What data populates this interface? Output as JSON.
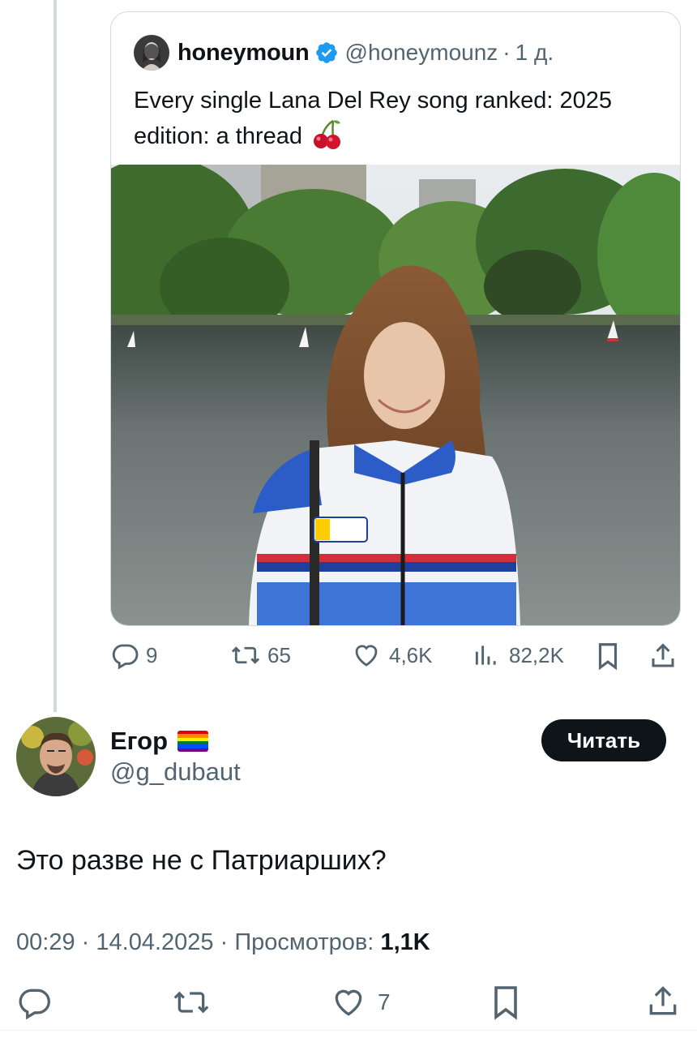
{
  "quoted_tweet": {
    "author_name": "honeymoun",
    "handle": "@honeymounz",
    "separator": "·",
    "time": "1 д.",
    "text": "Every single Lana Del Rey song ranked: 2025 edition: a thread",
    "emoji_icon": "cherries-icon",
    "photo_description_icon": "photo",
    "actions": {
      "replies": "9",
      "reposts": "65",
      "likes": "4,6K",
      "views": "82,2K"
    }
  },
  "tweet": {
    "author_name": "Егор",
    "flag_icon": "rainbow-flag-icon",
    "handle": "@g_dubaut",
    "follow_label": "Читать",
    "text": "Это разве не с Патриарших?",
    "time": "00:29",
    "date": "14.04.2025",
    "views_label": "Просмотров:",
    "views_count": "1,1K",
    "dot": "·",
    "likes": "7"
  },
  "colors": {
    "accent_verified": "#1d9bf0",
    "text_primary": "#0f1419",
    "text_secondary": "#536471",
    "border": "#cfd9de"
  }
}
